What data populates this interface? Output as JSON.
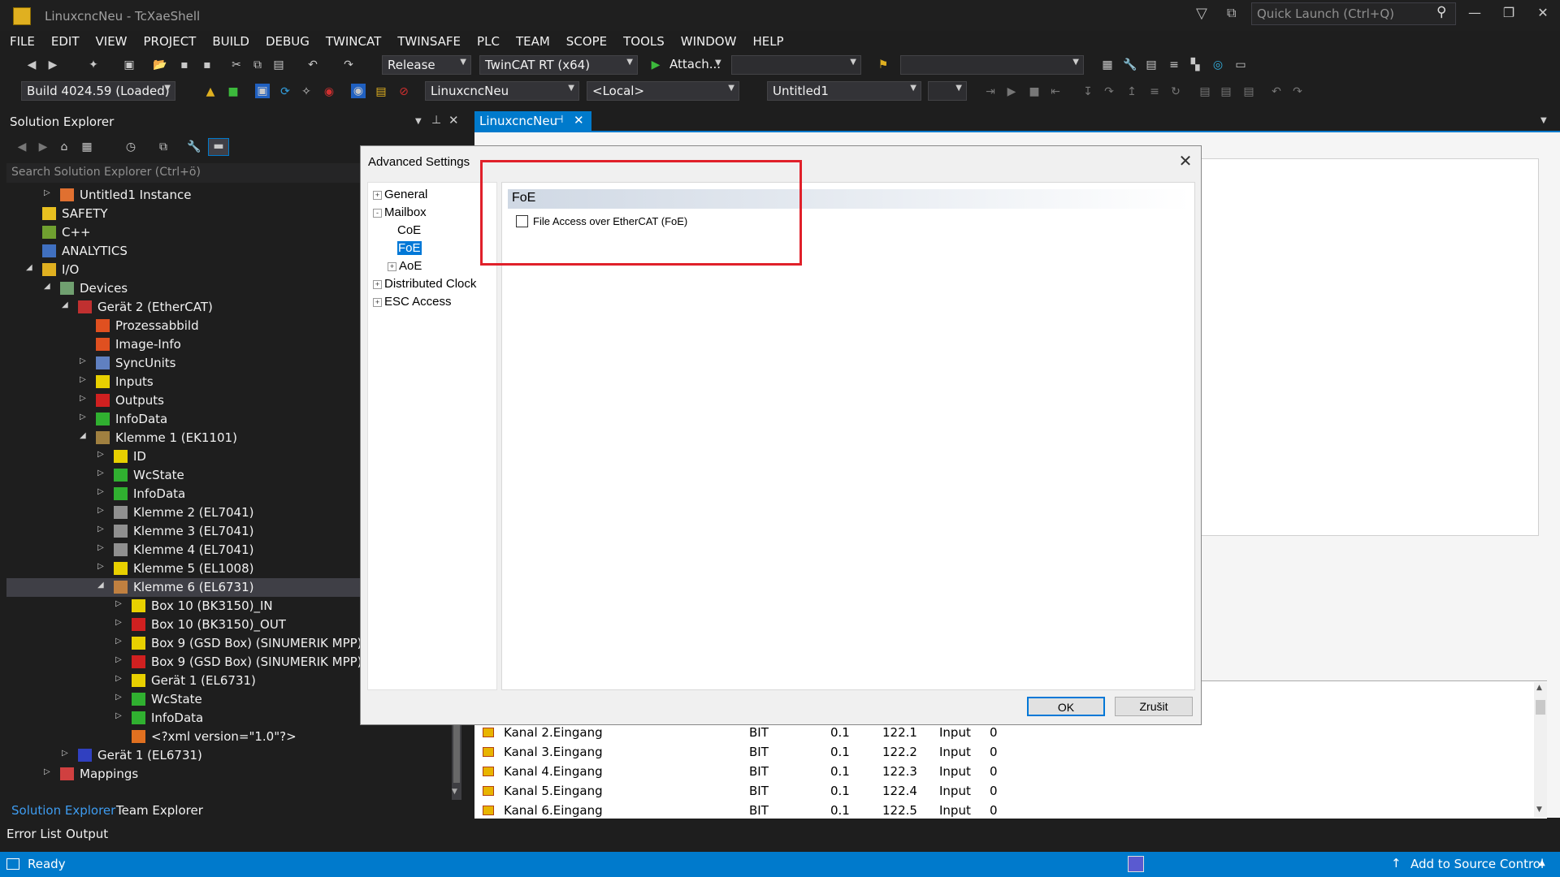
{
  "window": {
    "title": "LinuxcncNeu - TcXaeShell",
    "quick_launch_placeholder": "Quick Launch (Ctrl+Q)"
  },
  "menu": [
    "FILE",
    "EDIT",
    "VIEW",
    "PROJECT",
    "BUILD",
    "DEBUG",
    "TWINCAT",
    "TWINSAFE",
    "PLC",
    "TEAM",
    "SCOPE",
    "TOOLS",
    "WINDOW",
    "HELP"
  ],
  "toolbar": {
    "configuration": "Release",
    "platform": "TwinCAT RT (x64)",
    "attach_label": "Attach...",
    "build": "Build 4024.59 (Loaded)",
    "project": "LinuxcncNeu",
    "target": "<Local>",
    "plc_project": "Untitled1"
  },
  "solution_explorer": {
    "title": "Solution Explorer",
    "search_placeholder": "Search Solution Explorer (Ctrl+ö)",
    "items": [
      {
        "label": "Untitled1 Instance",
        "indent": 3,
        "arrow": "closed",
        "icon": "instance-icon",
        "color": "#e07030"
      },
      {
        "label": "SAFETY",
        "indent": 2,
        "arrow": "none",
        "icon": "safety-icon",
        "color": "#e8c020"
      },
      {
        "label": "C++",
        "indent": 2,
        "arrow": "none",
        "icon": "cpp-icon",
        "color": "#70a030"
      },
      {
        "label": "ANALYTICS",
        "indent": 2,
        "arrow": "none",
        "icon": "analytics-icon",
        "color": "#4070c0"
      },
      {
        "label": "I/O",
        "indent": 2,
        "arrow": "open",
        "icon": "io-icon",
        "color": "#e0b020"
      },
      {
        "label": "Devices",
        "indent": 3,
        "arrow": "open",
        "icon": "devices-icon",
        "color": "#70a070"
      },
      {
        "label": "Gerät 2 (EtherCAT)",
        "indent": 4,
        "arrow": "open",
        "icon": "ethercat-device-icon",
        "color": "#c03030"
      },
      {
        "label": "Prozessabbild",
        "indent": 5,
        "arrow": "none",
        "icon": "process-image-icon",
        "color": "#e05020"
      },
      {
        "label": "Image-Info",
        "indent": 5,
        "arrow": "none",
        "icon": "image-info-icon",
        "color": "#e05020"
      },
      {
        "label": "SyncUnits",
        "indent": 5,
        "arrow": "closed",
        "icon": "syncunits-icon",
        "color": "#6080c0"
      },
      {
        "label": "Inputs",
        "indent": 5,
        "arrow": "closed",
        "icon": "inputs-icon",
        "color": "#e8d000"
      },
      {
        "label": "Outputs",
        "indent": 5,
        "arrow": "closed",
        "icon": "outputs-icon",
        "color": "#d02020"
      },
      {
        "label": "InfoData",
        "indent": 5,
        "arrow": "closed",
        "icon": "infodata-icon",
        "color": "#30b030"
      },
      {
        "label": "Klemme 1 (EK1101)",
        "indent": 5,
        "arrow": "open",
        "icon": "terminal-icon",
        "color": "#a08040"
      },
      {
        "label": "ID",
        "indent": 6,
        "arrow": "closed",
        "icon": "id-icon",
        "color": "#e8d000"
      },
      {
        "label": "WcState",
        "indent": 6,
        "arrow": "closed",
        "icon": "wcstate-icon",
        "color": "#30b030"
      },
      {
        "label": "InfoData",
        "indent": 6,
        "arrow": "closed",
        "icon": "infodata-icon",
        "color": "#30b030"
      },
      {
        "label": "Klemme 2 (EL7041)",
        "indent": 6,
        "arrow": "closed",
        "icon": "terminal-icon",
        "color": "#909090"
      },
      {
        "label": "Klemme 3 (EL7041)",
        "indent": 6,
        "arrow": "closed",
        "icon": "terminal-icon",
        "color": "#909090"
      },
      {
        "label": "Klemme 4 (EL7041)",
        "indent": 6,
        "arrow": "closed",
        "icon": "terminal-icon",
        "color": "#909090"
      },
      {
        "label": "Klemme 5 (EL1008)",
        "indent": 6,
        "arrow": "closed",
        "icon": "terminal-icon",
        "color": "#e8d000"
      },
      {
        "label": "Klemme 6 (EL6731)",
        "indent": 6,
        "arrow": "open",
        "icon": "terminal-icon",
        "color": "#c08040",
        "selected": true
      },
      {
        "label": "Box 10  (BK3150)_IN",
        "indent": 7,
        "arrow": "closed",
        "icon": "inputs-icon",
        "color": "#e8d000"
      },
      {
        "label": "Box 10  (BK3150)_OUT",
        "indent": 7,
        "arrow": "closed",
        "icon": "outputs-icon",
        "color": "#d02020"
      },
      {
        "label": "Box 9 (GSD Box) (SINUMERIK MPP)_",
        "indent": 7,
        "arrow": "closed",
        "icon": "inputs-icon",
        "color": "#e8d000"
      },
      {
        "label": "Box 9 (GSD Box) (SINUMERIK MPP)_",
        "indent": 7,
        "arrow": "closed",
        "icon": "outputs-icon",
        "color": "#d02020"
      },
      {
        "label": "Gerät 1 (EL6731)",
        "indent": 7,
        "arrow": "closed",
        "icon": "inputs-icon",
        "color": "#e8d000"
      },
      {
        "label": "WcState",
        "indent": 7,
        "arrow": "closed",
        "icon": "wcstate-icon",
        "color": "#30b030"
      },
      {
        "label": "InfoData",
        "indent": 7,
        "arrow": "closed",
        "icon": "infodata-icon",
        "color": "#30b030"
      },
      {
        "label": "<?xml version=\"1.0\"?>",
        "indent": 7,
        "arrow": "none",
        "icon": "xml-icon",
        "color": "#e07020"
      },
      {
        "label": "Gerät 1 (EL6731)",
        "indent": 4,
        "arrow": "closed",
        "icon": "profibus-device-icon",
        "color": "#3040c0"
      },
      {
        "label": "Mappings",
        "indent": 3,
        "arrow": "closed",
        "icon": "mappings-icon",
        "color": "#d04040"
      }
    ],
    "tabs": [
      "Solution Explorer",
      "Team Explorer"
    ]
  },
  "bottom_tabs": [
    "Error List",
    "Output"
  ],
  "document": {
    "tab_label": "LinuxcncNeu",
    "grid_rows": [
      {
        "name": "Kanal 2.Eingang",
        "type": "BIT",
        "size": "0.1",
        "addr": "122.1",
        "io": "Input",
        "user": "0"
      },
      {
        "name": "Kanal 3.Eingang",
        "type": "BIT",
        "size": "0.1",
        "addr": "122.2",
        "io": "Input",
        "user": "0"
      },
      {
        "name": "Kanal 4.Eingang",
        "type": "BIT",
        "size": "0.1",
        "addr": "122.3",
        "io": "Input",
        "user": "0"
      },
      {
        "name": "Kanal 5.Eingang",
        "type": "BIT",
        "size": "0.1",
        "addr": "122.4",
        "io": "Input",
        "user": "0"
      },
      {
        "name": "Kanal 6.Eingang",
        "type": "BIT",
        "size": "0.1",
        "addr": "122.5",
        "io": "Input",
        "user": "0"
      }
    ]
  },
  "dialog": {
    "title": "Advanced Settings",
    "tree": [
      {
        "label": "General",
        "indent": 0,
        "pm": "+"
      },
      {
        "label": "Mailbox",
        "indent": 0,
        "pm": "-"
      },
      {
        "label": "CoE",
        "indent": 1,
        "pm": ""
      },
      {
        "label": "FoE",
        "indent": 1,
        "pm": "",
        "selected": true
      },
      {
        "label": "AoE",
        "indent": 1,
        "pm": "+"
      },
      {
        "label": "Distributed Clock",
        "indent": 0,
        "pm": "+"
      },
      {
        "label": "ESC Access",
        "indent": 0,
        "pm": "+"
      }
    ],
    "section_header": "FoE",
    "checkbox_label": "File Access over EtherCAT (FoE)",
    "checkbox_checked": false,
    "ok_label": "OK",
    "cancel_label": "Zrušit"
  },
  "status": {
    "text": "Ready",
    "source_control": "Add to Source Control"
  },
  "colors": {
    "accent": "#007acc",
    "highlight_box": "#e0202a"
  }
}
